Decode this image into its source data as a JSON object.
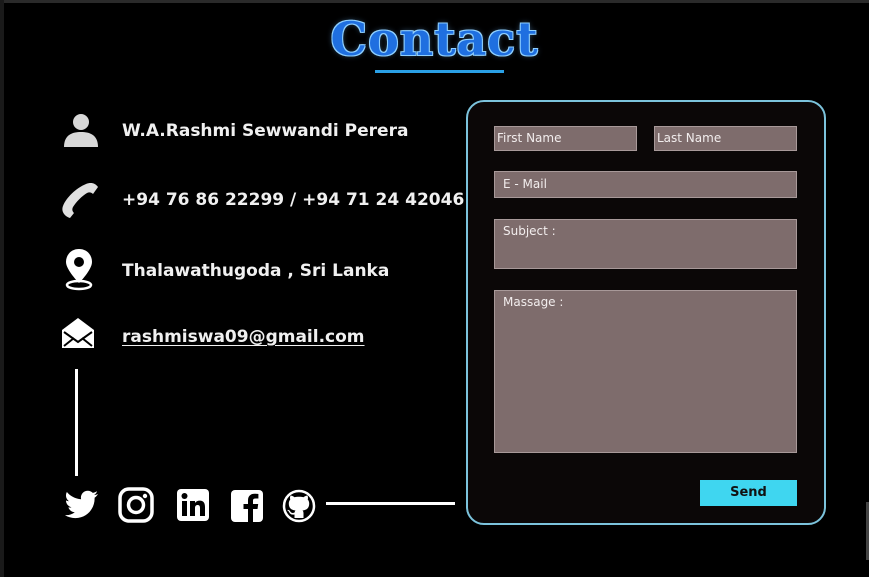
{
  "page": {
    "title": "Contact"
  },
  "contact": {
    "name": "W.A.Rashmi Sewwandi Perera",
    "phone": "+94 76 86 22299 / +94 71  24 42046",
    "location": "Thalawathugoda , Sri Lanka",
    "email": "rashmiswa09@gmail.com"
  },
  "icons": {
    "person": "person-icon",
    "phone": "phone-icon",
    "location": "location-pin-icon",
    "email": "envelope-icon"
  },
  "social": [
    {
      "name": "twitter-icon"
    },
    {
      "name": "instagram-icon"
    },
    {
      "name": "linkedin-icon"
    },
    {
      "name": "facebook-icon"
    },
    {
      "name": "github-icon"
    }
  ],
  "form": {
    "first_name_placeholder": "First Name",
    "last_name_placeholder": "Last Name",
    "email_placeholder": "E - Mail",
    "subject_placeholder": "Subject :",
    "message_placeholder": "Massage :",
    "send_label": "Send"
  },
  "colors": {
    "title": "#1f6fe0",
    "title_outline": "#8fd0ff",
    "underline": "#2aa0e6",
    "panel_border": "#7cc3dc",
    "field_bg": "#7e6c6c",
    "send_button": "#3fd6f0"
  }
}
